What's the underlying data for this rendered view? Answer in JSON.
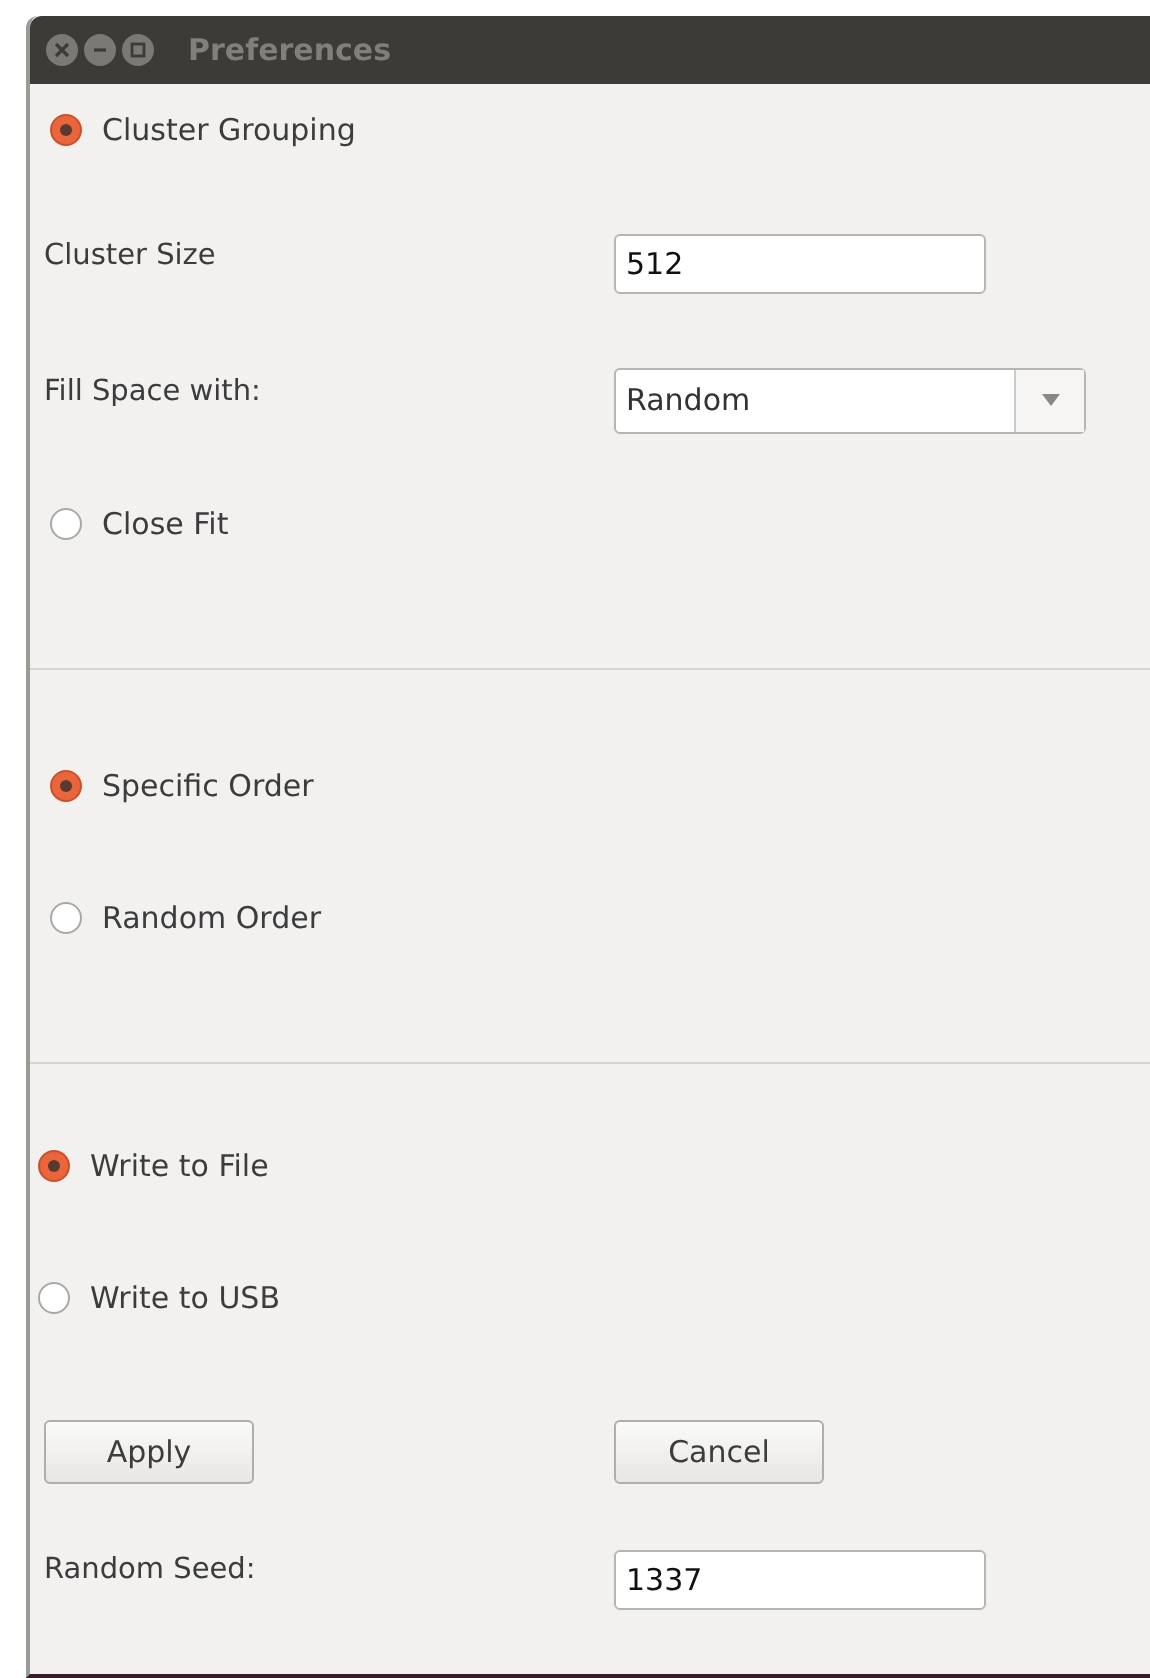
{
  "window": {
    "title": "Preferences"
  },
  "grouping": {
    "options": [
      {
        "label": "Cluster Grouping",
        "selected": true
      },
      {
        "label": "Close Fit",
        "selected": false
      }
    ],
    "cluster_size": {
      "label": "Cluster Size",
      "value": "512"
    },
    "fill_space": {
      "label": "Fill Space with:",
      "value": "Random"
    }
  },
  "order": {
    "options": [
      {
        "label": "Specific Order",
        "selected": true
      },
      {
        "label": "Random Order",
        "selected": false
      }
    ]
  },
  "output": {
    "options": [
      {
        "label": "Write to File",
        "selected": true
      },
      {
        "label": "Write to USB",
        "selected": false
      }
    ]
  },
  "buttons": [
    "Apply",
    "Cancel"
  ],
  "random_seed": {
    "label": "Random Seed:",
    "value": "1337"
  }
}
